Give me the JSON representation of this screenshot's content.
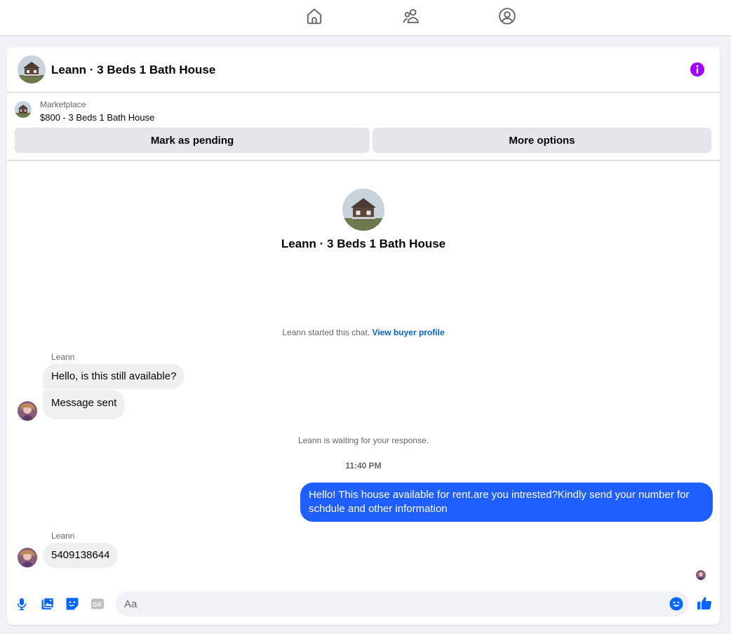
{
  "topnav": {
    "icons": [
      "home-icon",
      "people-icon",
      "profile-circle-icon"
    ]
  },
  "header": {
    "title": "Leann · 3 Beds 1 Bath House",
    "info_icon": "info-icon"
  },
  "marketplace": {
    "label": "Marketplace",
    "listing": "$800 - 3 Beds 1 Bath House",
    "buttons": {
      "pending": "Mark as pending",
      "more": "More options"
    }
  },
  "conversation": {
    "title": "Leann · 3 Beds 1 Bath House",
    "started_text": "Leann started this chat.",
    "started_link": "View buyer profile",
    "waiting_text": "Leann is waiting for your response.",
    "timestamp": "11:40 PM",
    "messages": [
      {
        "sender": "Leann",
        "text": "Hello, is this still available?"
      },
      {
        "sender": "Leann",
        "text": "Message sent"
      },
      {
        "sender": "me",
        "text": "Hello! This house available for rent.are you intrested?Kindly send your number for schdule and other information"
      },
      {
        "sender": "Leann",
        "text": "5409138644"
      }
    ]
  },
  "composer": {
    "placeholder": "Aa",
    "icons": [
      "microphone-icon",
      "photo-icon",
      "sticker-icon",
      "gif-icon",
      "emoji-icon",
      "thumbs-up-icon"
    ]
  },
  "colors": {
    "accent": "#1f5fff",
    "info": "#a100ff",
    "link": "#0064d1",
    "icon_blue": "#0866ff"
  }
}
